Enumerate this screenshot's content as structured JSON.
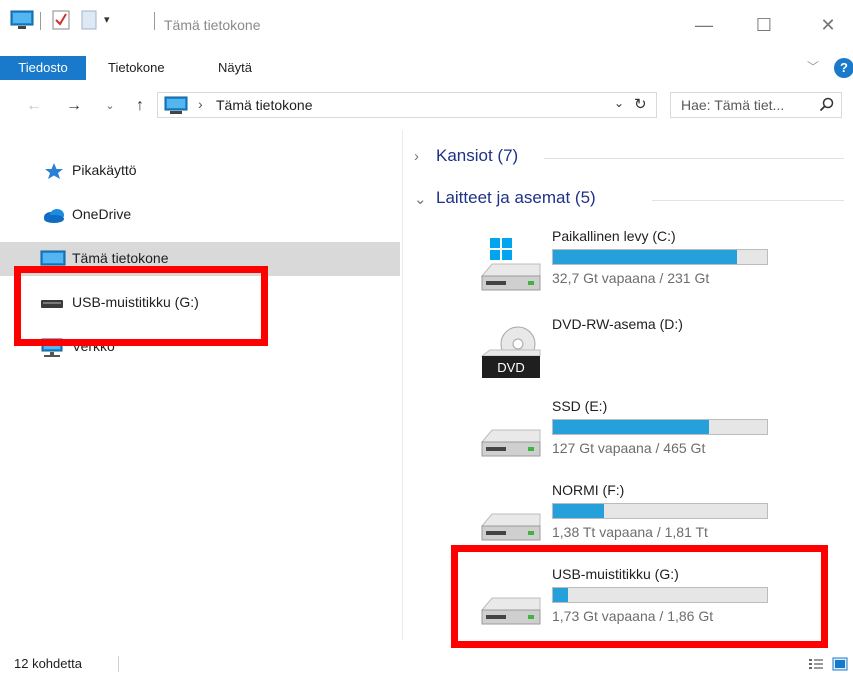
{
  "window": {
    "title": "Tämä tietokone",
    "controls": {
      "minimize": "—",
      "maximize": "☐",
      "close": "✕"
    }
  },
  "ribbon": {
    "tabs": [
      {
        "label": "Tiedosto"
      },
      {
        "label": "Tietokone"
      },
      {
        "label": "Näytä"
      }
    ],
    "help": "?"
  },
  "address_bar": {
    "path": "Tämä tietokone",
    "search_placeholder": "Hae: Tämä tiet..."
  },
  "nav_pane": {
    "items": [
      {
        "label": "Pikakäyttö",
        "icon": "star-icon"
      },
      {
        "label": "OneDrive",
        "icon": "cloud-icon"
      },
      {
        "label": "Tämä tietokone",
        "icon": "computer-icon",
        "selected": true
      },
      {
        "label": "USB-muistitikku (G:)",
        "icon": "usb-drive-icon"
      },
      {
        "label": "Verkko",
        "icon": "network-icon"
      }
    ]
  },
  "content": {
    "groups": [
      {
        "label": "Kansiot (7)",
        "expanded": false
      },
      {
        "label": "Laitteet ja asemat (5)",
        "expanded": true
      }
    ],
    "drives": [
      {
        "name": "Paikallinen levy (C:)",
        "free": "32,7 Gt vapaana / 231 Gt",
        "used_fraction": 0.86,
        "icon": "windows-drive-icon"
      },
      {
        "name": "DVD-RW-asema (D:)",
        "icon": "dvd-drive-icon",
        "badge": "DVD"
      },
      {
        "name": "SSD (E:)",
        "free": "127 Gt vapaana / 465 Gt",
        "used_fraction": 0.73,
        "icon": "hard-drive-icon"
      },
      {
        "name": "NORMI (F:)",
        "free": "1,38 Tt vapaana / 1,81 Tt",
        "used_fraction": 0.24,
        "icon": "hard-drive-icon"
      },
      {
        "name": "USB-muistitikku (G:)",
        "free": "1,73 Gt vapaana / 1,86 Gt",
        "used_fraction": 0.07,
        "icon": "hard-drive-icon"
      }
    ]
  },
  "status_bar": {
    "count": "12 kohdetta"
  },
  "colors": {
    "accent": "#1979ca",
    "progress": "#26a0da",
    "selection": "#d9d9d9",
    "highlight": "#ff0000"
  }
}
